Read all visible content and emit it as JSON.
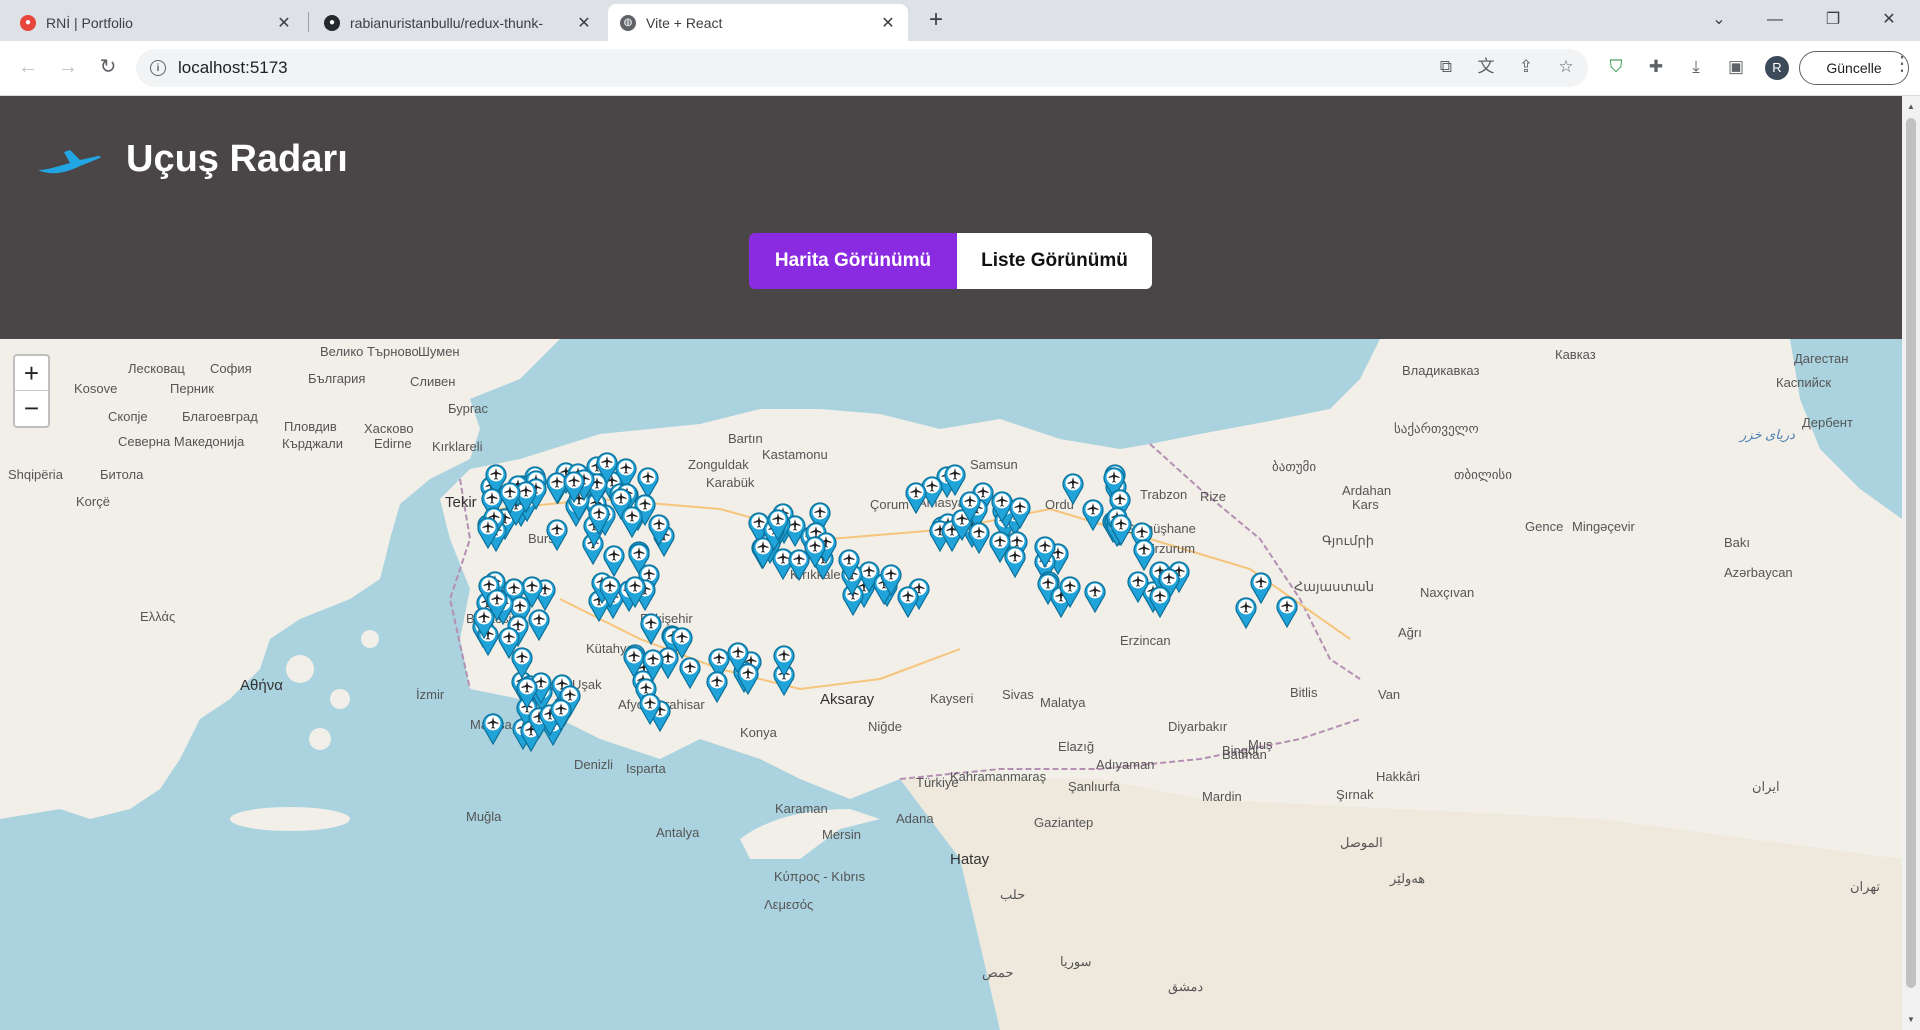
{
  "browser": {
    "tabs": [
      {
        "title": "RNİ | Portfolio",
        "favicon": "portfolio-icon"
      },
      {
        "title": "rabianuristanbullu/redux-thunk-",
        "favicon": "github-icon"
      },
      {
        "title": "Vite + React",
        "favicon": "globe-icon"
      }
    ],
    "url": "localhost:5173",
    "update_label": "Güncelle",
    "avatar_letter": "R"
  },
  "app": {
    "title": "Uçuş Radarı",
    "views": {
      "map": "Harita Görünümü",
      "list": "Liste Görünümü"
    },
    "active_view": "map",
    "accent_color": "#8a2be2",
    "header_color": "#4a4546"
  },
  "map": {
    "zoom_in": "+",
    "zoom_out": "−",
    "marker_color": "#1fa3d8",
    "labels": [
      "Велико Търново",
      "Шумен",
      "Лесковац",
      "София",
      "България",
      "Сливен",
      "Kosove",
      "Перник",
      "Бургас",
      "Скопје",
      "Благоевград",
      "Пловдив",
      "Хасково",
      "Северна Македонија",
      "Кърджали",
      "Edirne",
      "Kırklareli",
      "Shqipëria",
      "Битола",
      "Tekir",
      "Korçë",
      "Ελλάς",
      "Αθήνα",
      "Κύπρος - Kıbrıs",
      "Λεμεσός",
      "Bartın",
      "Kastamonu",
      "Zonguldak",
      "Karabük",
      "Samsun",
      "Amasya",
      "Ordu",
      "Rize",
      "Trabzon",
      "Gümüşhane",
      "Erzurum",
      "Kars",
      "Ardahan",
      "Çorum",
      "Kırıkkale",
      "Eskişehir",
      "Balıkesir",
      "Bursa",
      "Kütahya",
      "Uşak",
      "İzmir",
      "Manisa",
      "Muğla",
      "Denizli",
      "Isparta",
      "Afyonkarahisar",
      "Konya",
      "Karaman",
      "Antalya",
      "Mersin",
      "Adana",
      "Aksaray",
      "Niğde",
      "Kayseri",
      "Sivas",
      "Malatya",
      "Elazığ",
      "Bingöl",
      "Muş",
      "Bitlis",
      "Van",
      "Ağrı",
      "Erzincan",
      "Diyarbakır",
      "Batman",
      "Mardin",
      "Şırnak",
      "Hakkâri",
      "Adıyaman",
      "Kahramanmaraş",
      "Şanlıurfa",
      "Gaziantep",
      "Hatay",
      "Türkiye",
      "Кавказ",
      "Владикавказ",
      "Дагестан",
      "Каспийск",
      "Дербент",
      "საქართველო",
      "თბილისი",
      "ბათუმი",
      "Gence",
      "Mingəçevir",
      "Bakı",
      "Azərbaycan",
      "Naxçıvan",
      "Հայաստան",
      "Գյումրի",
      "دریای خزر",
      "تهران",
      "ایران",
      "الموصل",
      "هەولێر",
      "حلب",
      "سوريا",
      "حمص",
      "دمشق"
    ],
    "marker_count": 200
  }
}
